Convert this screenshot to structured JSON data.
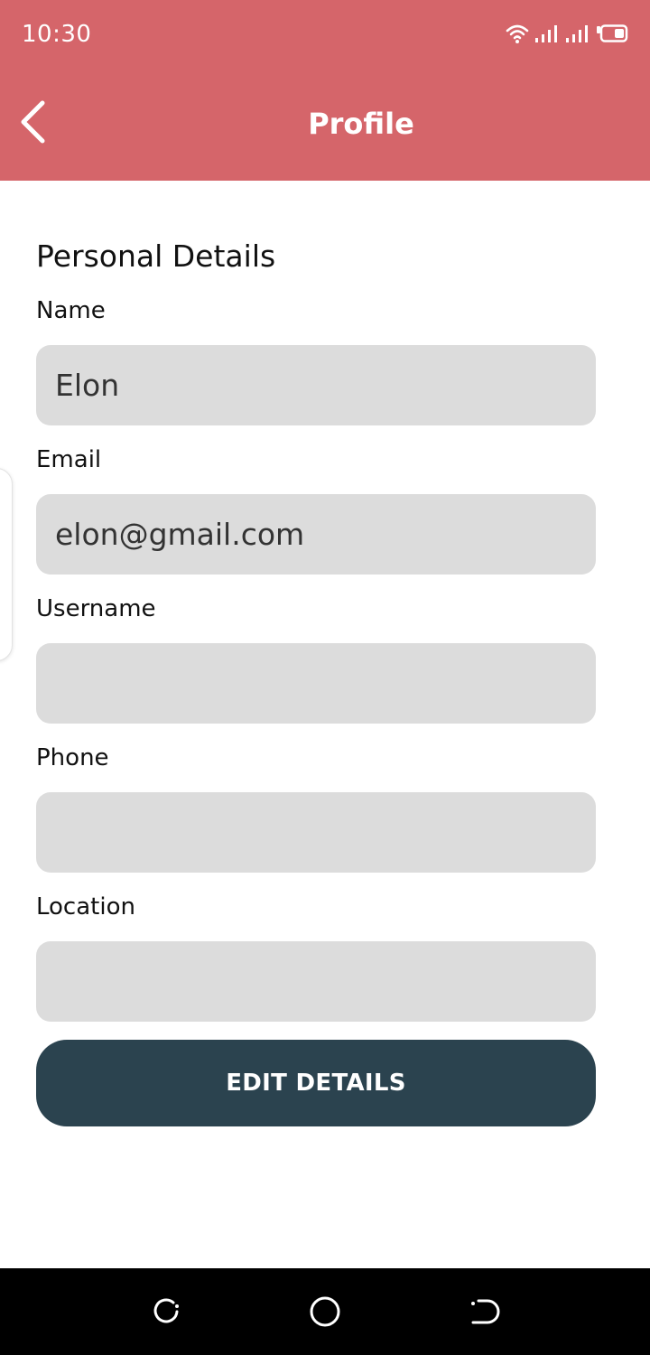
{
  "status_bar": {
    "time": "10:30",
    "icons": [
      "wifi-icon",
      "signal-icon",
      "signal-icon",
      "battery-icon"
    ]
  },
  "app_bar": {
    "title": "Profile",
    "back_icon": "chevron-left-icon"
  },
  "form": {
    "section_title": "Personal Details",
    "fields": [
      {
        "label": "Name",
        "value": "Elon"
      },
      {
        "label": "Email",
        "value": "elon@gmail.com"
      },
      {
        "label": "Username",
        "value": ""
      },
      {
        "label": "Phone",
        "value": ""
      },
      {
        "label": "Location",
        "value": ""
      }
    ],
    "submit_label": "EDIT DETAILS"
  },
  "nav_bar": {
    "buttons": [
      "recents-icon",
      "home-icon",
      "back-icon"
    ]
  },
  "colors": {
    "header": "#d5656a",
    "input_bg": "#dcdcdc",
    "button_bg": "#2b434f"
  }
}
